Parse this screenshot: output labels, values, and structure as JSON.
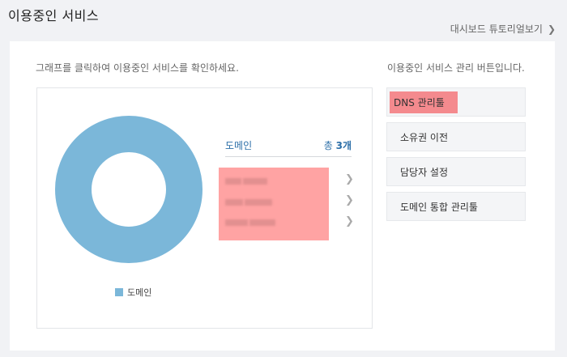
{
  "header": {
    "title": "이용중인 서비스",
    "tutorial_link": "대시보드 튜토리얼보기"
  },
  "chart_panel": {
    "instruction": "그래프를 클릭하여 이용중인 서비스를 확인하세요.",
    "summary_label": "도메인",
    "summary_count_prefix": "총",
    "summary_count_value": "3개"
  },
  "chart_data": {
    "type": "pie",
    "categories": [
      "도메인"
    ],
    "values": [
      3
    ],
    "legend": [
      "도메인"
    ],
    "colors": [
      "#7bb7d9"
    ],
    "donut": true
  },
  "management": {
    "title": "이용중인 서비스 관리 버튼입니다.",
    "buttons": [
      {
        "label": "DNS 관리툴"
      },
      {
        "label": "소유권 이전"
      },
      {
        "label": "담당자 설정"
      },
      {
        "label": "도메인 통합 관리툴"
      }
    ]
  },
  "colors": {
    "donut": "#7bb7d9",
    "accent_text": "#2c6fa8",
    "redaction": "#ffa3a3"
  }
}
